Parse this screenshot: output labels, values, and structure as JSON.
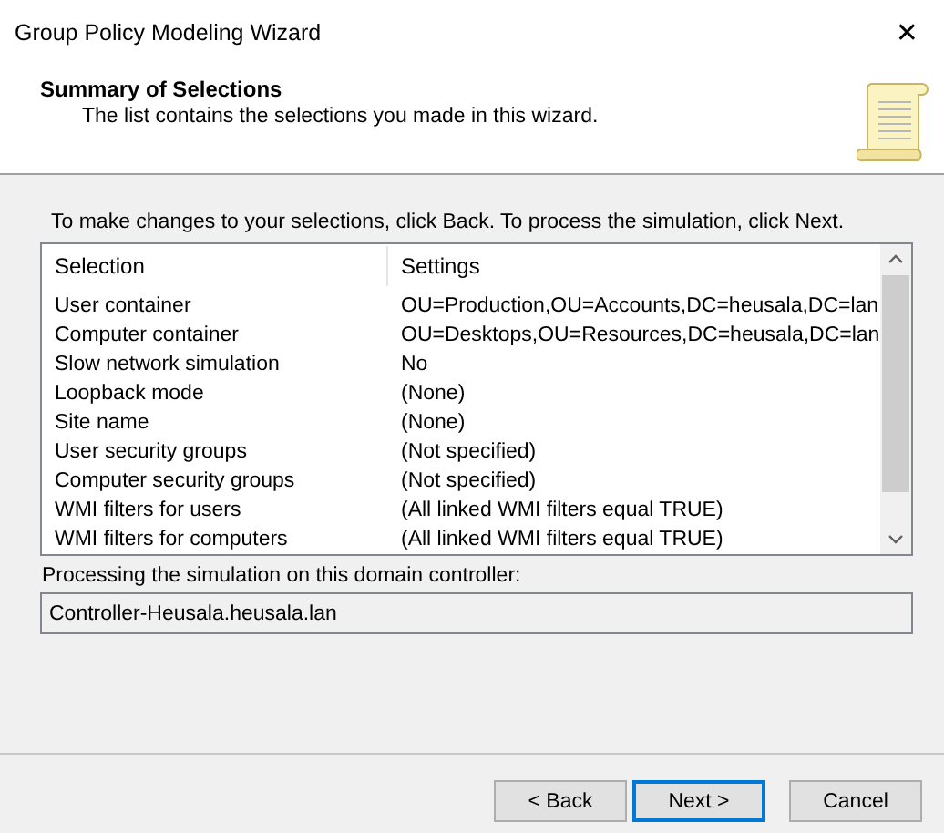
{
  "window": {
    "title": "Group Policy Modeling Wizard",
    "close": "✕"
  },
  "header": {
    "title": "Summary of Selections",
    "subtitle": "The list contains the selections you made in this wizard."
  },
  "instruction": "To make changes to your selections, click Back. To process the simulation, click Next.",
  "table": {
    "columns": [
      "Selection",
      "Settings"
    ],
    "rows": [
      [
        "User container",
        "OU=Production,OU=Accounts,DC=heusala,DC=lan"
      ],
      [
        "Computer container",
        "OU=Desktops,OU=Resources,DC=heusala,DC=lan"
      ],
      [
        "Slow network simulation",
        "No"
      ],
      [
        "Loopback mode",
        "(None)"
      ],
      [
        "Site name",
        "(None)"
      ],
      [
        "User security groups",
        "(Not specified)"
      ],
      [
        "Computer security groups",
        "(Not specified)"
      ],
      [
        "WMI filters for users",
        "(All linked WMI filters equal TRUE)"
      ],
      [
        "WMI filters for computers",
        "(All linked WMI filters equal TRUE)"
      ]
    ]
  },
  "controller": {
    "label": "Processing the simulation on this domain controller:",
    "value": "Controller-Heusala.heusala.lan"
  },
  "buttons": [
    {
      "label": "< Back",
      "default": false
    },
    {
      "label": "Next >",
      "default": true
    },
    {
      "label": "Cancel",
      "default": false
    }
  ]
}
